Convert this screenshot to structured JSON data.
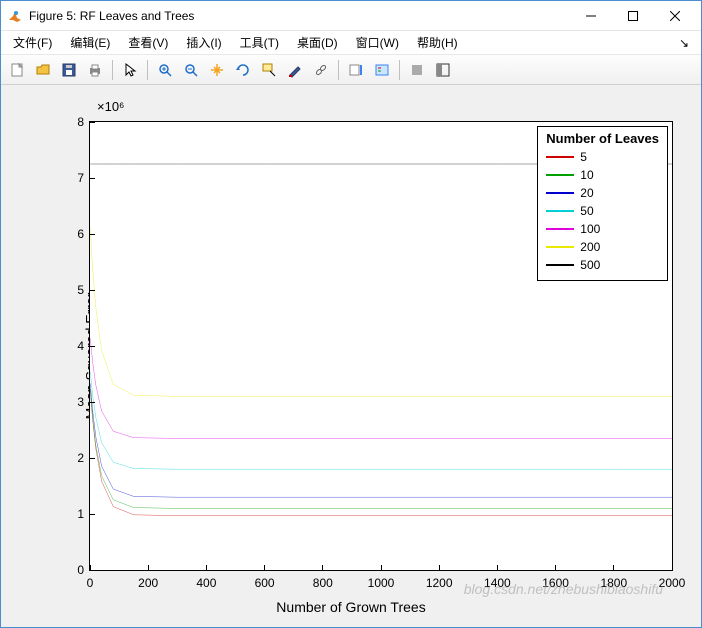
{
  "window": {
    "title": "Figure 5: RF Leaves and Trees"
  },
  "menus": {
    "file": "文件(F)",
    "edit": "编辑(E)",
    "view": "查看(V)",
    "insert": "插入(I)",
    "tools": "工具(T)",
    "desktop": "桌面(D)",
    "window": "窗口(W)",
    "help": "帮助(H)"
  },
  "toolbar_icons": [
    "new",
    "open",
    "save",
    "print",
    "pointer",
    "zoom-in",
    "zoom-out",
    "pan",
    "rotate",
    "data-cursor",
    "brush",
    "link",
    "colorbar",
    "legend",
    "dock",
    "undock",
    "restore"
  ],
  "watermark": "blog.csdn.net/zhebushibiaoshifu",
  "chart_data": {
    "type": "line",
    "title": "",
    "xlabel": "Number of Grown Trees",
    "ylabel": "Mean Squared Error",
    "y_exponent_label": "×10⁶",
    "xlim": [
      0,
      2000
    ],
    "ylim": [
      0,
      8
    ],
    "y_scale_factor": 1000000,
    "xticks": [
      0,
      200,
      400,
      600,
      800,
      1000,
      1200,
      1400,
      1600,
      1800,
      2000
    ],
    "yticks": [
      0,
      1,
      2,
      3,
      4,
      5,
      6,
      7,
      8
    ],
    "legend": {
      "title": "Number of Leaves",
      "position": "northeast",
      "entries": [
        "5",
        "10",
        "20",
        "50",
        "100",
        "200",
        "500"
      ]
    },
    "series": [
      {
        "name": "5",
        "color": "#cc0000",
        "initial_y": 3.3,
        "steady_y": 0.97
      },
      {
        "name": "10",
        "color": "#00a000",
        "initial_y": 3.3,
        "steady_y": 1.1
      },
      {
        "name": "20",
        "color": "#0000cc",
        "initial_y": 3.4,
        "steady_y": 1.3
      },
      {
        "name": "50",
        "color": "#00d0d0",
        "initial_y": 3.6,
        "steady_y": 1.8
      },
      {
        "name": "100",
        "color": "#e000e0",
        "initial_y": 4.2,
        "steady_y": 2.35
      },
      {
        "name": "200",
        "color": "#e8e800",
        "initial_y": 6.2,
        "steady_y": 3.1
      },
      {
        "name": "500",
        "color": "#000000",
        "initial_y": 7.25,
        "steady_y": 7.25
      }
    ]
  }
}
